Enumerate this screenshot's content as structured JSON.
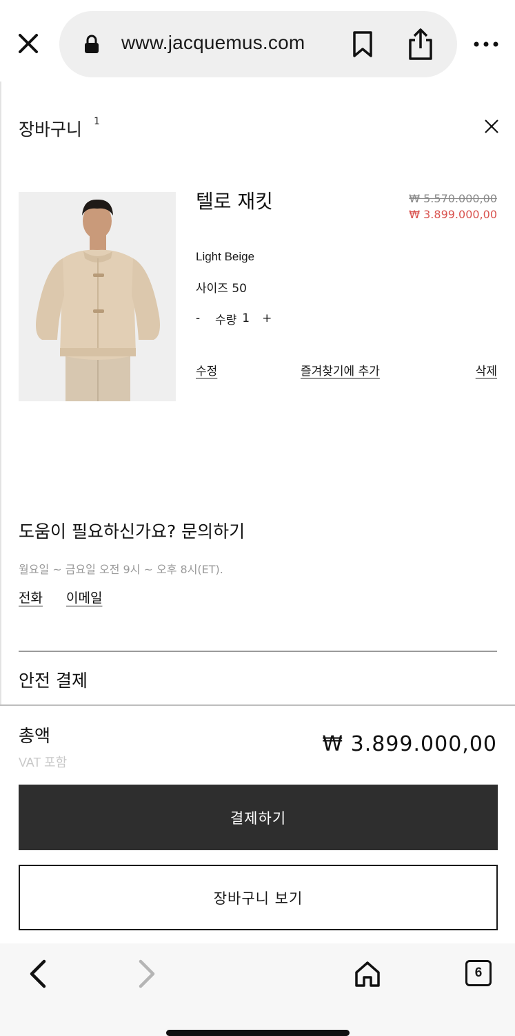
{
  "browser": {
    "url": "www.jacquemus.com",
    "tab_count": "6"
  },
  "cart": {
    "title": "장바구니",
    "count": "1"
  },
  "product": {
    "name": "텔로 재킷",
    "price_original": "₩ 5.570.000,00",
    "price_sale": "₩ 3.899.000,00",
    "color": "Light Beige",
    "size": "사이즈 50",
    "qty_minus": "-",
    "qty_label": "수량",
    "qty_value": "1",
    "qty_plus": "+",
    "action_edit": "수정",
    "action_favorite": "즐겨찾기에 추가",
    "action_delete": "삭제"
  },
  "help": {
    "title": "도움이 필요하신가요? 문의하기",
    "hours": "월요일 ~ 금요일 오전 9시 ~ 오후 8시(ET).",
    "phone_link": "전화",
    "email_link": "이메일"
  },
  "secure_payment": "안전 결제",
  "summary": {
    "total_label": "총액",
    "vat_note": "VAT 포함",
    "total_amount": "₩ 3.899.000,00",
    "pay_button": "결제하기",
    "view_cart_button": "장바구니 보기"
  },
  "colors": {
    "sale_price": "#d9534f",
    "primary_button": "#2e2e2e",
    "jacket": "#e2cfb5"
  },
  "icons": [
    "close-icon",
    "lock-icon",
    "bookmark-icon",
    "share-icon",
    "more-icon",
    "back-icon",
    "forward-icon",
    "home-icon",
    "tabs-icon"
  ]
}
